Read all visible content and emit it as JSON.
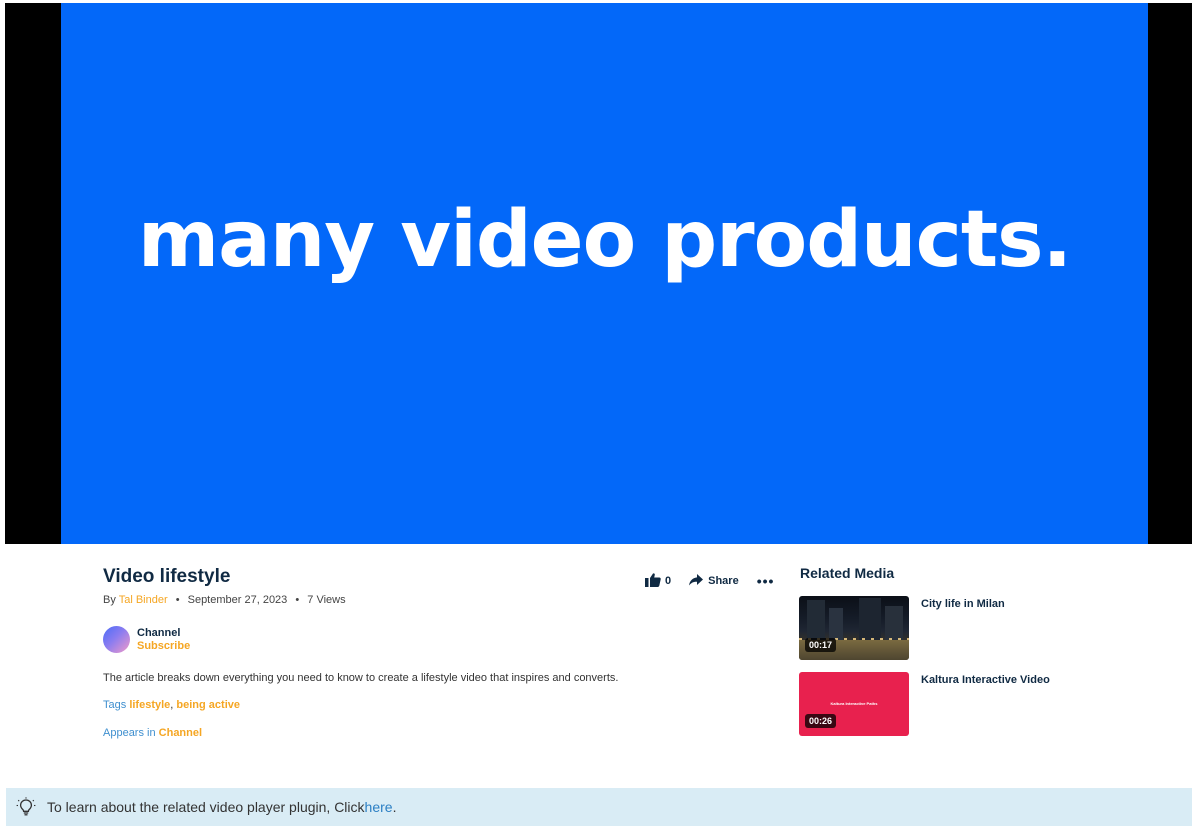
{
  "player": {
    "caption": "many video products."
  },
  "entry": {
    "title": "Video lifestyle",
    "by_label": "By",
    "owner": "Tal Binder",
    "date": "September 27, 2023",
    "views": "7 Views",
    "likes": "0",
    "share_label": "Share",
    "more_label": "•••",
    "channel_name": "Channel",
    "subscribe_label": "Subscribe",
    "description": "The article breaks down everything you need to know to create a lifestyle video that inspires and converts.",
    "tags_label": "Tags",
    "tags": [
      "lifestyle",
      "being active"
    ],
    "appears_label": "Appears in",
    "appears_channel": "Channel"
  },
  "related": {
    "title": "Related Media",
    "items": [
      {
        "name": "City life in Milan",
        "duration": "00:17"
      },
      {
        "name": "Kaltura Interactive Video",
        "duration": "00:26",
        "thumb_text": "Kaltura Interactive Paths"
      }
    ]
  },
  "note": {
    "text": "To learn about the related video player plugin, Click",
    "link": "here",
    "period": "."
  },
  "colors": {
    "player_bg": "#0368f9",
    "accent": "#f5a623",
    "link": "#3f8fcf",
    "title": "#102a43",
    "note_bg": "#d9ecf5"
  },
  "icons": [
    "thumbs-up-icon",
    "share-arrow-icon",
    "more-icon",
    "lightbulb-icon"
  ]
}
